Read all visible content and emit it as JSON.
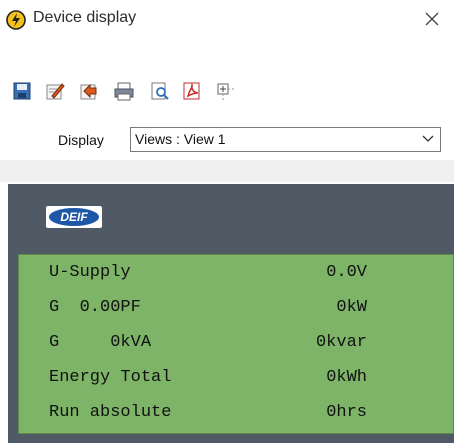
{
  "window": {
    "title": "Device display"
  },
  "toolbar": {
    "buttons": [
      {
        "icon": "save-icon"
      },
      {
        "icon": "edit-icon"
      },
      {
        "icon": "compare-icon"
      },
      {
        "icon": "print-icon"
      },
      {
        "icon": "print-preview-icon"
      },
      {
        "icon": "export-pdf-icon"
      },
      {
        "icon": "zoom-icon"
      }
    ]
  },
  "display": {
    "label": "Display",
    "selected": "Views : View 1"
  },
  "brand": {
    "logo_text": "DEIF",
    "logo_color": "#1f57a7"
  },
  "screen": {
    "background": "#7eb468",
    "rows": [
      {
        "left": "U-Supply",
        "right": "0.0V"
      },
      {
        "left": "G  0.00PF",
        "right": "0kW"
      },
      {
        "left": "G     0kVA",
        "right": "0kvar"
      },
      {
        "left": "Energy Total",
        "right": "0kWh"
      },
      {
        "left": "Run absolute",
        "right": "0hrs"
      }
    ]
  }
}
